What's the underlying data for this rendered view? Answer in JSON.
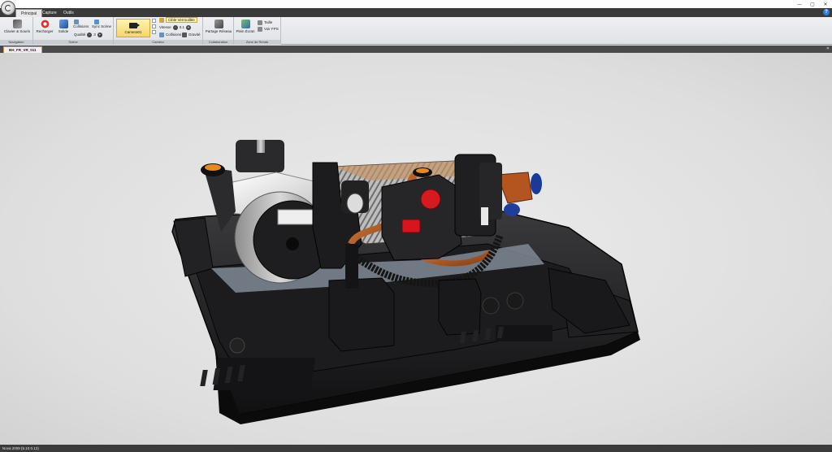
{
  "window": {
    "controls": {
      "minimize": "—",
      "maximize": "▢",
      "close": "✕"
    }
  },
  "ribbon_tabs": [
    {
      "label": "Principal",
      "active": true
    },
    {
      "label": "Capture",
      "active": false
    },
    {
      "label": "Outils",
      "active": false
    }
  ],
  "help": "?",
  "ribbon": {
    "navigation": {
      "label": "Navigation",
      "clavier_souris": "Clavier & Souris"
    },
    "scene": {
      "label": "Scène",
      "recharger": "Recharger",
      "solide": "Solide",
      "collisions": "Collisions",
      "sync_scene": "Sync Scène",
      "qualite": "Qualité",
      "qualite_value": "3"
    },
    "camera": {
      "label": "Caméra",
      "camera_name": "Camera01",
      "cible_verrouillee": "Cible Verrouillée",
      "vitesse": "Vitesse",
      "vitesse_value": "0.1",
      "collisions": "Collisions",
      "gravite": "Gravité"
    },
    "collaboration": {
      "label": "Collaboration",
      "partage_reseau": "Partage Réseau"
    },
    "zone_rendu": {
      "label": "Zone de Rendu",
      "plein_ecran": "Plein Écran",
      "taille": "Taille",
      "voir_fps": "Voir FPS"
    }
  },
  "document": {
    "tab": "BH_FR_VR_011",
    "close": "✕"
  },
  "status": {
    "text": "Nova 2009 (5.10.0.12)"
  },
  "colors": {
    "accent_orange": "#c77a1c",
    "help_blue": "#2f7fd8",
    "camera_highlight": "#f5d76a"
  }
}
